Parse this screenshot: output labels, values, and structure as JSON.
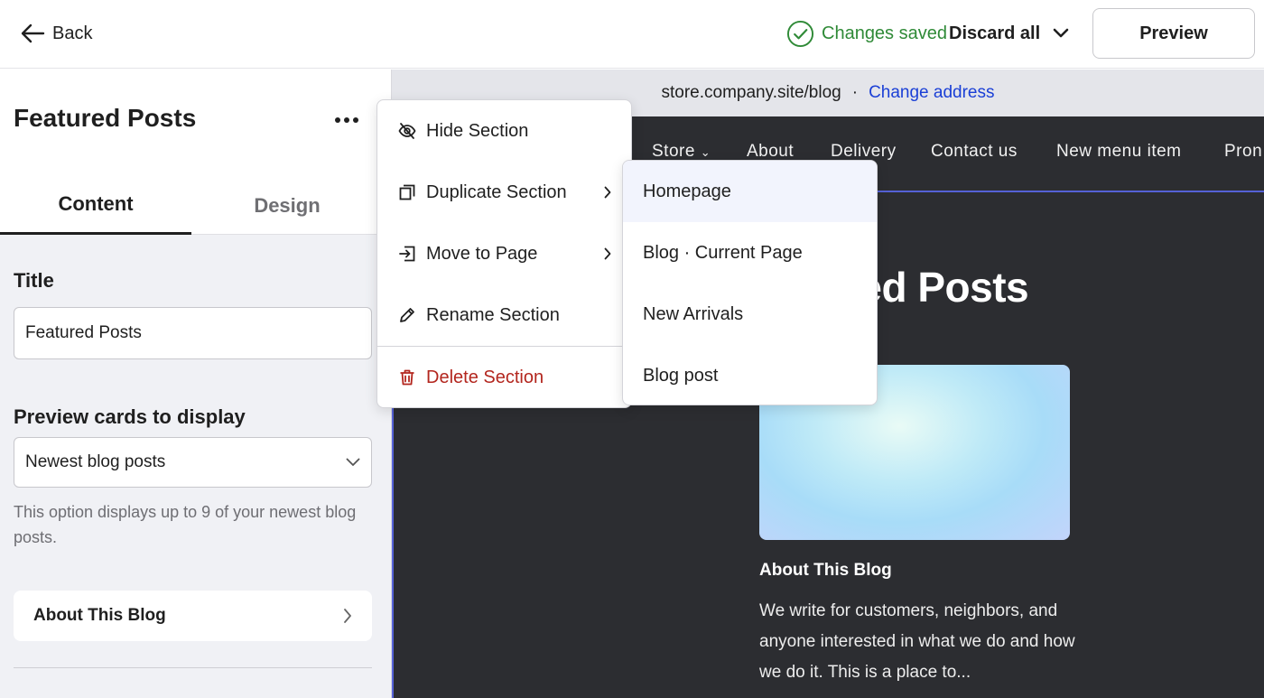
{
  "topbar": {
    "back_label": "Back",
    "saved_label": "Changes saved",
    "discard_label": "Discard all",
    "preview_label": "Preview",
    "saved_color": "#2f8a37"
  },
  "sidebar": {
    "section_title": "Featured Posts",
    "tabs": [
      {
        "label": "Content",
        "active": true
      },
      {
        "label": "Design",
        "active": false
      }
    ],
    "title_label": "Title",
    "title_value": "Featured Posts",
    "cards_label": "Preview cards to display",
    "cards_selected": "Newest blog posts",
    "cards_helper": "This option displays up to 9 of your newest blog posts.",
    "about_row_label": "About This Blog"
  },
  "preview": {
    "address": "store.company.site/blog",
    "address_sep": "·",
    "change_address_label": "Change address",
    "nav_items": [
      "Store",
      "About",
      "Delivery",
      "Contact us",
      "New menu item",
      "Pron"
    ],
    "hero_title_visible": "red Posts",
    "card_title": "About This Blog",
    "card_body": "We write for customers, neighbors, and anyone interested in what we do and how we do it. This is a place to..."
  },
  "context_menu": {
    "items": [
      {
        "label": "Hide Section",
        "icon": "eye-off-icon"
      },
      {
        "label": "Duplicate Section",
        "icon": "duplicate-icon",
        "has_submenu": true
      },
      {
        "label": "Move to Page",
        "icon": "move-to-page-icon",
        "has_submenu": true
      },
      {
        "label": "Rename Section",
        "icon": "pencil-icon"
      },
      {
        "label": "Delete Section",
        "icon": "trash-icon",
        "danger": true
      }
    ],
    "danger_color": "#b3261e"
  },
  "submenu": {
    "items": [
      {
        "label": "Homepage",
        "highlighted": true
      },
      {
        "label": "Blog · Current Page"
      },
      {
        "label": "New Arrivals"
      },
      {
        "label": "Blog post"
      }
    ]
  }
}
